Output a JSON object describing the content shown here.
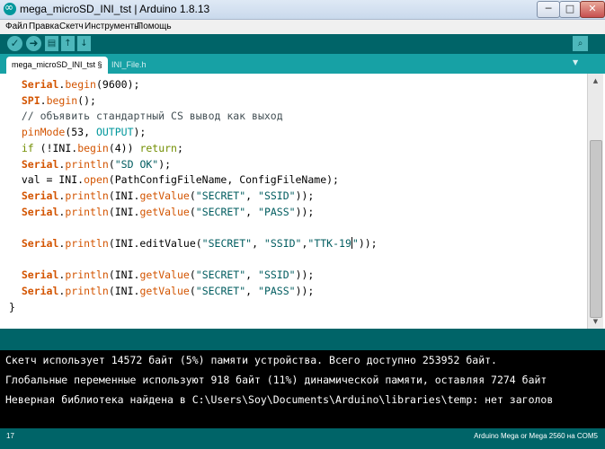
{
  "window": {
    "title": "mega_microSD_INI_tst | Arduino 1.8.13",
    "minimize_glyph": "─",
    "maximize_glyph": "□",
    "close_glyph": "✕"
  },
  "menu": [
    "Файл",
    "Правка",
    "Скетч",
    "Инструменты",
    "Помощь"
  ],
  "toolbar": {
    "verify_icon": "✓",
    "upload_icon": "➜",
    "new_icon": "▤",
    "open_icon": "↑",
    "save_icon": "↓",
    "serial_monitor_icon": "⌕"
  },
  "tabs": {
    "active": "mega_microSD_INI_tst §",
    "other": "INI_File.h",
    "menu_icon": "▼"
  },
  "code_lines": [
    "  Serial.begin(9600);",
    "  SPI.begin();",
    "  // объявить стандартный CS вывод как выход",
    "  pinMode(53, OUTPUT);",
    "  if (!INI.begin(4)) return;",
    "  Serial.println(\"SD OK\");",
    "  val = INI.open(PathConfigFileName, ConfigFileName);",
    "  Serial.println(INI.getValue(\"SECRET\", \"SSID\"));",
    "  Serial.println(INI.getValue(\"SECRET\", \"PASS\"));",
    "",
    "  Serial.println(INI.editValue(\"SECRET\", \"SSID\",\"TTK-19\"));",
    "",
    "  Serial.println(INI.getValue(\"SECRET\", \"SSID\"));",
    "  Serial.println(INI.getValue(\"SECRET\", \"PASS\"));",
    "}"
  ],
  "console_lines": [
    "Скетч использует 14572 байт (5%) памяти устройства. Всего доступно 253952 байт.",
    "Глобальные переменные используют 918 байт (11%) динамической памяти, оставляя 7274 байт",
    "Неверная библиотека найдена в C:\\Users\\Soy\\Documents\\Arduino\\libraries\\temp: нет заголов"
  ],
  "footer": {
    "line_number": "17",
    "board": "Arduino Mega or Mega 2560 на COM5"
  },
  "colors": {
    "toolbar_bg": "#006468",
    "tabbar_bg": "#17a1a5",
    "keyword_orange": "#d35400",
    "keyword_green": "#728e00",
    "constant_teal": "#00979c",
    "string_dark_teal": "#005c5f"
  }
}
